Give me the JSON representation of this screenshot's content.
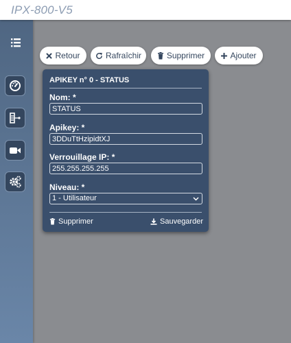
{
  "app": {
    "title": "IPX-800-V5"
  },
  "sidebar": {
    "items": [
      {
        "id": "menu",
        "icon": "list-icon"
      },
      {
        "id": "dashboard",
        "icon": "gauge-icon"
      },
      {
        "id": "devices",
        "icon": "device-tree-icon"
      },
      {
        "id": "camera",
        "icon": "video-camera-icon"
      },
      {
        "id": "settings",
        "icon": "gears-icon"
      }
    ]
  },
  "toolbar": {
    "back_label": "Retour",
    "refresh_label": "Rafraîchir",
    "delete_label": "Supprimer",
    "add_label": "Ajouter"
  },
  "card": {
    "title": "APIKEY n° 0 - STATUS",
    "fields": {
      "name": {
        "label": "Nom: *",
        "value": "STATUS"
      },
      "apikey": {
        "label": "Apikey: *",
        "value": "3DDuTtHzipidtXJ"
      },
      "ip_lock": {
        "label": "Verrouillage IP: *",
        "value": "255.255.255.255"
      },
      "level": {
        "label": "Niveau: *",
        "value": "1 - Utilisateur"
      }
    },
    "delete_label": "Supprimer",
    "save_label": "Sauvegarder"
  },
  "colors": {
    "background": "#8a8c90",
    "sidebar": "#5a7391",
    "card": "#3a4f6c",
    "title_text": "#8d9db3",
    "button_text": "#34465e"
  }
}
